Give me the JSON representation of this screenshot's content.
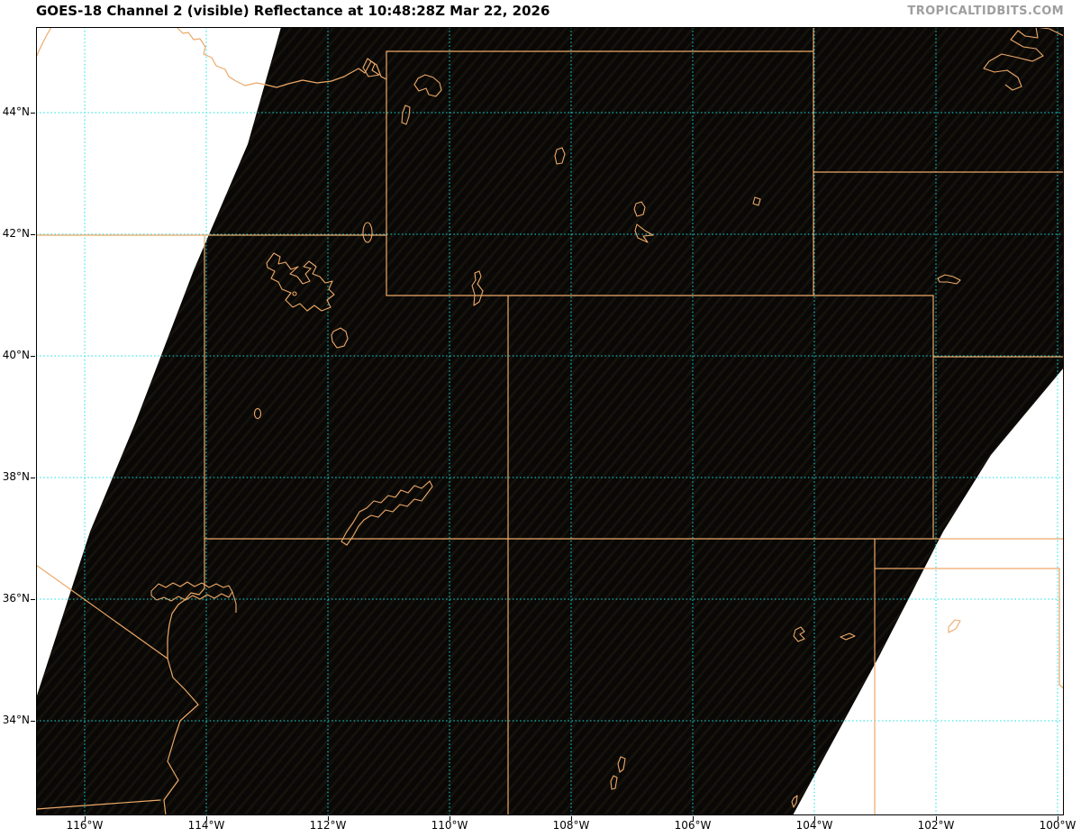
{
  "header": {
    "title": "GOES-18 Channel 2 (visible) Reflectance at 10:48:28Z Mar 22, 2026",
    "watermark": "TROPICALTIDBITS.COM"
  },
  "map": {
    "x_axis": {
      "tick_labels": [
        "116°W",
        "114°W",
        "112°W",
        "110°W",
        "108°W",
        "106°W",
        "104°W",
        "102°W",
        "100°W"
      ]
    },
    "y_axis": {
      "tick_labels": [
        "44°N",
        "42°N",
        "40°N",
        "38°N",
        "36°N",
        "34°N"
      ]
    },
    "colors": {
      "background": "#ffffff",
      "scan_area": "#0a0907",
      "state_lines": "#eda868",
      "gridlines": "#12e2e2",
      "title_text": "#000000",
      "watermark_text": "#9e9e9e"
    },
    "features": [
      "satellite-scan-area",
      "state-borders",
      "mexico-border",
      "california-nevada-border",
      "colorado-river",
      "great-salt-lake",
      "utah-lake",
      "bear-lake",
      "sevier-lake",
      "yellowstone-lake",
      "jackson-lake",
      "hebgen-lake",
      "boysen-reservoir",
      "seminoe-reservoir",
      "pathfinder-reservoir",
      "glendo-reservoir",
      "flaming-gorge-reservoir",
      "lake-powell",
      "lake-mead",
      "lake-mcconaughy",
      "conchas-lake",
      "ute-reservoir",
      "lake-meredith",
      "elephant-butte-reservoir",
      "caballo-reservoir",
      "missouri-river",
      "pecos-river"
    ]
  }
}
